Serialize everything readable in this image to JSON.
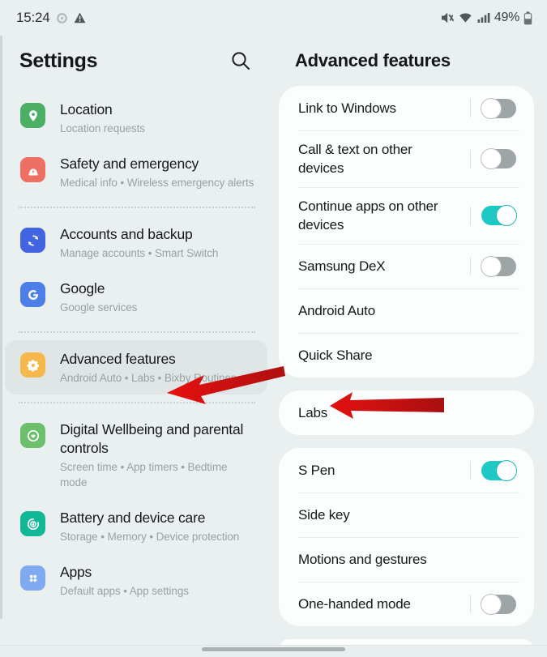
{
  "status_bar": {
    "clock": "15:24",
    "battery_percent": "49%",
    "left_icons": [
      "gear-spinner-icon",
      "warning-triangle-icon"
    ],
    "right_icons": [
      "mute-icon",
      "wifi-icon",
      "signal-bars-icon",
      "battery-icon"
    ]
  },
  "sidebar": {
    "title": "Settings",
    "search_icon": "search-icon",
    "items": [
      {
        "label": "Location",
        "sub": "Location requests",
        "icon": "location-pin-icon",
        "color": "#4caf66",
        "selected": false
      },
      {
        "label": "Safety and emergency",
        "sub": "Medical info  •  Wireless emergency alerts",
        "icon": "emergency-siren-icon",
        "color": "#ee6f64",
        "selected": false
      },
      {
        "label": "Accounts and backup",
        "sub": "Manage accounts  •  Smart Switch",
        "icon": "sync-accounts-icon",
        "color": "#4264e0",
        "selected": false
      },
      {
        "label": "Google",
        "sub": "Google services",
        "icon": "google-g-icon",
        "color": "#4e7fe8",
        "selected": false
      },
      {
        "label": "Advanced features",
        "sub": "Android Auto  •  Labs  •  Bixby Routines",
        "icon": "advanced-gear-icon",
        "color": "#f6b githubfalse",
        "selected": true
      },
      {
        "label": "Digital Wellbeing and parental controls",
        "sub": "Screen time  •  App timers  •  Bedtime mode",
        "icon": "wellbeing-heart-icon",
        "color": "#6cbf6c",
        "selected": false
      },
      {
        "label": "Battery and device care",
        "sub": "Storage  •  Memory  •  Device protection",
        "icon": "device-care-icon",
        "color": "#12b795",
        "selected": false
      },
      {
        "label": "Apps",
        "sub": "Default apps  •  App settings",
        "icon": "apps-grid-icon",
        "color": "#7fa9f0",
        "selected": false
      }
    ]
  },
  "detail": {
    "title": "Advanced features",
    "groups": [
      {
        "rows": [
          {
            "label": "Link to Windows",
            "toggle": "off"
          },
          {
            "label": "Call & text on other devices",
            "toggle": "off"
          },
          {
            "label": "Continue apps on other devices",
            "toggle": "on"
          },
          {
            "label": "Samsung DeX",
            "toggle": "off"
          },
          {
            "label": "Android Auto",
            "toggle": "none"
          },
          {
            "label": "Quick Share",
            "toggle": "none"
          }
        ]
      },
      {
        "rows": [
          {
            "label": "Labs",
            "toggle": "none"
          }
        ]
      },
      {
        "rows": [
          {
            "label": "S Pen",
            "toggle": "on"
          },
          {
            "label": "Side key",
            "toggle": "none"
          },
          {
            "label": "Motions and gestures",
            "toggle": "none"
          },
          {
            "label": "One-handed mode",
            "toggle": "off"
          }
        ]
      }
    ]
  },
  "annotations": {
    "arrow_color": "#d41414",
    "arrows": [
      {
        "name": "arrow-to-advanced-features",
        "points_to": "Advanced features"
      },
      {
        "name": "arrow-to-labs",
        "points_to": "Labs"
      }
    ]
  },
  "colors": {
    "accent_teal": "#1ec9c4",
    "background": "#eaefef",
    "card": "#fcfdfd",
    "selected_row": "#e0e5e5",
    "annotation_red": "#d41414"
  },
  "nav_bar": {
    "home_indicator": "home-indicator"
  }
}
